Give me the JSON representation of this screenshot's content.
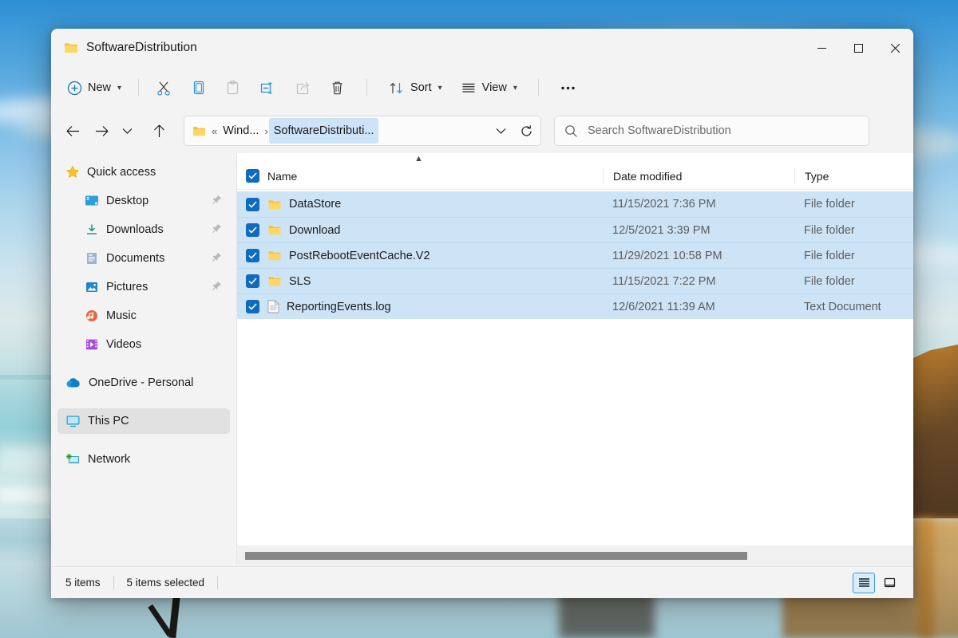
{
  "window": {
    "title": "SoftwareDistribution",
    "icon": "folder-icon",
    "minimize_label": "–",
    "maximize_label": "☐",
    "close_label": "✕"
  },
  "toolbar": {
    "new_label": "New",
    "sort_label": "Sort",
    "view_label": "View",
    "more_label": "•••",
    "items": [
      {
        "name": "new-button",
        "label": "New",
        "icon": "plus-circle-icon",
        "enabled": true
      },
      {
        "name": "cut-button",
        "label": "",
        "icon": "scissors-icon",
        "enabled": true
      },
      {
        "name": "copy-button",
        "label": "",
        "icon": "copy-icon",
        "enabled": true
      },
      {
        "name": "paste-button",
        "label": "",
        "icon": "paste-icon",
        "enabled": false
      },
      {
        "name": "rename-button",
        "label": "",
        "icon": "rename-icon",
        "enabled": true
      },
      {
        "name": "share-button",
        "label": "",
        "icon": "share-icon",
        "enabled": false
      },
      {
        "name": "delete-button",
        "label": "",
        "icon": "trash-icon",
        "enabled": true
      },
      {
        "name": "sort-button",
        "label": "Sort",
        "icon": "sort-arrows-icon",
        "enabled": true
      },
      {
        "name": "view-button",
        "label": "View",
        "icon": "list-lines-icon",
        "enabled": true
      },
      {
        "name": "see-more-button",
        "label": "•••",
        "icon": "ellipsis-icon",
        "enabled": true
      }
    ]
  },
  "nav": {
    "back_icon": "arrow-left-icon",
    "forward_icon": "arrow-right-icon",
    "recent_icon": "chevron-down-icon",
    "up_icon": "arrow-up-icon",
    "breadcrumb": {
      "folder_icon": "folder-icon",
      "overflow": "«",
      "segments": [
        {
          "label": "Wind...",
          "active": false
        },
        {
          "label": "SoftwareDistributi...",
          "active": true
        }
      ],
      "separator": "›",
      "dropdown_icon": "chevron-down-icon",
      "refresh_icon": "refresh-icon"
    }
  },
  "search": {
    "icon": "search-icon",
    "placeholder": "Search SoftwareDistribution",
    "value": ""
  },
  "sidebar": {
    "items": [
      {
        "label": "Quick access",
        "icon": "star-icon",
        "indent": false,
        "pinned": false,
        "selected": false
      },
      {
        "label": "Desktop",
        "icon": "desktop-icon",
        "indent": true,
        "pinned": true,
        "selected": false
      },
      {
        "label": "Downloads",
        "icon": "download-icon",
        "indent": true,
        "pinned": true,
        "selected": false
      },
      {
        "label": "Documents",
        "icon": "documents-icon",
        "indent": true,
        "pinned": true,
        "selected": false
      },
      {
        "label": "Pictures",
        "icon": "pictures-icon",
        "indent": true,
        "pinned": true,
        "selected": false
      },
      {
        "label": "Music",
        "icon": "music-icon",
        "indent": true,
        "pinned": false,
        "selected": false
      },
      {
        "label": "Videos",
        "icon": "videos-icon",
        "indent": true,
        "pinned": false,
        "selected": false
      },
      {
        "label": "OneDrive - Personal",
        "icon": "cloud-icon",
        "indent": false,
        "pinned": false,
        "selected": false,
        "gap_before": true
      },
      {
        "label": "This PC",
        "icon": "this-pc-icon",
        "indent": false,
        "pinned": false,
        "selected": true,
        "gap_before": true
      },
      {
        "label": "Network",
        "icon": "network-icon",
        "indent": false,
        "pinned": false,
        "selected": false,
        "gap_before": true
      }
    ]
  },
  "filelist": {
    "select_all_checked": true,
    "sort_column": "Name",
    "sort_direction": "ascending",
    "columns": [
      {
        "key": "name",
        "label": "Name"
      },
      {
        "key": "date",
        "label": "Date modified"
      },
      {
        "key": "type",
        "label": "Type"
      }
    ],
    "rows": [
      {
        "name": "DataStore",
        "date": "11/15/2021 7:36 PM",
        "type": "File folder",
        "icon": "folder-icon",
        "checked": true,
        "selected": true
      },
      {
        "name": "Download",
        "date": "12/5/2021 3:39 PM",
        "type": "File folder",
        "icon": "folder-icon",
        "checked": true,
        "selected": true
      },
      {
        "name": "PostRebootEventCache.V2",
        "date": "11/29/2021 10:58 PM",
        "type": "File folder",
        "icon": "folder-icon",
        "checked": true,
        "selected": true
      },
      {
        "name": "SLS",
        "date": "11/15/2021 7:22 PM",
        "type": "File folder",
        "icon": "folder-icon",
        "checked": true,
        "selected": true
      },
      {
        "name": "ReportingEvents.log",
        "date": "12/6/2021 11:39 AM",
        "type": "Text Document",
        "icon": "text-file-icon",
        "checked": true,
        "selected": true
      }
    ]
  },
  "statusbar": {
    "item_count": "5 items",
    "selection_count": "5 items selected",
    "view_details_icon": "details-view-icon",
    "view_tiles_icon": "large-icons-view-icon",
    "active_view": "details"
  },
  "colors": {
    "accent": "#0f6cbd",
    "selection": "#cde4f7",
    "window_chrome": "#f3f3f3",
    "folder_yellow": "#fcd45f",
    "sidebar_selected": "#e1e1e1"
  }
}
